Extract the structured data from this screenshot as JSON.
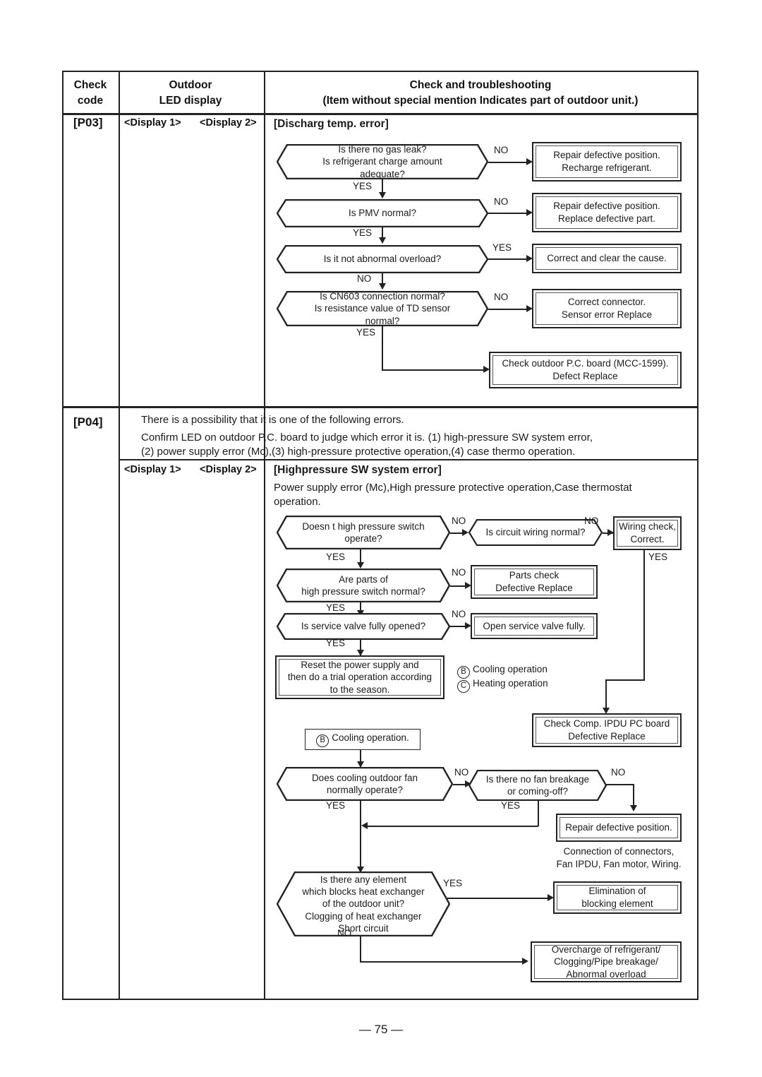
{
  "page": {
    "footer": "— 75 —"
  },
  "table": {
    "headers": {
      "col1_line1": "Check",
      "col1_line2": "code",
      "col2_line1": "Outdoor",
      "col2_line2": "LED display",
      "col3_line1": "Check and troubleshooting",
      "col3_line2": "(Item without special mention Indicates part of outdoor unit.)"
    },
    "rows": [
      {
        "code": "[P03]",
        "display1": "<Display 1>",
        "display2": "<Display 2>",
        "title": "[Discharg temp. error]"
      },
      {
        "code": "[P04]",
        "intro_line1": "There is a possibility that it is one of the following errors.",
        "intro_line2": "Confirm LED on outdoor P.C. board to judge which error it is.  (1) high-pressure SW system error,",
        "intro_line3": "(2) power supply error (Mc),(3) high-pressure protective operation,(4) case thermo operation.",
        "display1": "<Display 1>",
        "display2": "<Display 2>",
        "title": "[Highpressure SW system error]",
        "subtitle_line1": "Power supply error (Mc),High pressure protective operation,Case thermostat",
        "subtitle_line2": "operation."
      }
    ]
  },
  "flow_p03": {
    "nodes": [
      {
        "id": "d1",
        "type": "decision",
        "lines": [
          "Is there no gas leak?",
          "Is refrigerant charge amount adequate?"
        ]
      },
      {
        "id": "r1",
        "type": "result",
        "lines": [
          "Repair defective position.",
          "Recharge refrigerant."
        ]
      },
      {
        "id": "d2",
        "type": "decision",
        "lines": [
          "Is PMV normal?"
        ]
      },
      {
        "id": "r2",
        "type": "result",
        "lines": [
          "Repair defective position.",
          "Replace defective part."
        ]
      },
      {
        "id": "d3",
        "type": "decision",
        "lines": [
          "Is it not abnormal overload?"
        ]
      },
      {
        "id": "r3",
        "type": "result",
        "lines": [
          "Correct and clear the cause."
        ]
      },
      {
        "id": "d4",
        "type": "decision",
        "lines": [
          "Is CN603 connection normal?",
          "Is resistance value of TD sensor normal?"
        ]
      },
      {
        "id": "r4",
        "type": "result",
        "lines": [
          "Correct connector.",
          "Sensor error      Replace"
        ]
      },
      {
        "id": "r5",
        "type": "result",
        "lines": [
          "Check outdoor P.C. board (MCC-1599).",
          "Defect      Replace"
        ]
      }
    ],
    "branch_labels": {
      "d1_no": "NO",
      "d1_yes": "YES",
      "d2_no": "NO",
      "d2_yes": "YES",
      "d3_yes": "YES",
      "d3_no": "NO",
      "d4_no": "NO",
      "d4_yes": "YES"
    }
  },
  "flow_p04": {
    "nodes": [
      {
        "id": "e1",
        "type": "decision",
        "lines": [
          "Doesn t high pressure switch",
          "operate?"
        ]
      },
      {
        "id": "e2",
        "type": "decision",
        "lines": [
          "Is circuit wiring normal?"
        ]
      },
      {
        "id": "e3",
        "type": "result",
        "lines": [
          "Wiring check,",
          "Correct."
        ]
      },
      {
        "id": "e4",
        "type": "decision",
        "lines": [
          "Are parts of",
          "high pressure switch normal?"
        ]
      },
      {
        "id": "e5",
        "type": "result",
        "lines": [
          "Parts check",
          "Defective      Replace"
        ]
      },
      {
        "id": "e6",
        "type": "decision",
        "lines": [
          "Is service valve fully opened?"
        ]
      },
      {
        "id": "e7",
        "type": "result",
        "lines": [
          "Open service valve fully."
        ]
      },
      {
        "id": "e8",
        "type": "result",
        "lines": [
          "Reset the power supply and",
          "then do a trial operation according",
          "to the season."
        ]
      },
      {
        "id": "e9",
        "type": "result",
        "lines": [
          "Check Comp. IPDU PC board",
          "Defective      Replace"
        ]
      },
      {
        "id": "e10",
        "type": "plain",
        "lines": [
          "Cooling operation."
        ],
        "circle": "B"
      },
      {
        "id": "e11",
        "type": "decision",
        "lines": [
          "Does cooling outdoor fan",
          "normally operate?"
        ]
      },
      {
        "id": "e12",
        "type": "decision",
        "lines": [
          "Is there no fan breakage",
          "or coming-off?"
        ]
      },
      {
        "id": "e13",
        "type": "result",
        "lines": [
          "Repair defective position."
        ]
      },
      {
        "id": "e14",
        "type": "decision",
        "lines": [
          "Is there any element",
          "which blocks heat exchanger",
          "of the outdoor unit?",
          "Clogging of heat exchanger",
          "Short circuit"
        ]
      },
      {
        "id": "e15",
        "type": "result",
        "lines": [
          "Elimination of",
          "blocking element"
        ]
      },
      {
        "id": "e16",
        "type": "result",
        "lines": [
          "Overcharge of refrigerant/",
          "Clogging/Pipe breakage/",
          "Abnormal overload"
        ]
      }
    ],
    "legend": [
      {
        "symbol": "B",
        "text": "Cooling operation"
      },
      {
        "symbol": "C",
        "text": "Heating operation"
      }
    ],
    "notes": {
      "connectors_line1": "Connection of connectors,",
      "connectors_line2": "Fan IPDU, Fan motor, Wiring."
    },
    "branch_labels": {
      "e1_no": "NO",
      "e1_yes": "YES",
      "e2_no": "NO",
      "e3_yes": "YES",
      "e4_no": "NO",
      "e4_yes": "YES",
      "e6_no": "NO",
      "e6_yes": "YES",
      "e11_no": "NO",
      "e11_yes": "YES",
      "e12_no": "NO",
      "e12_yes": "YES",
      "e14_yes": "YES",
      "e14_no": "NO"
    }
  }
}
